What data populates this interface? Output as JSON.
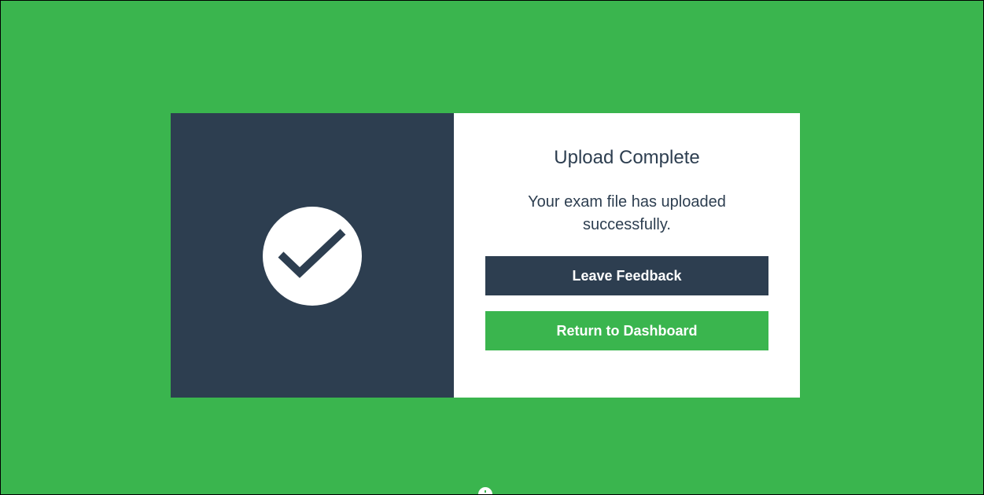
{
  "colors": {
    "background": "#3ab54e",
    "panel_dark": "#2d3e50",
    "panel_light": "#ffffff",
    "accent_green": "#3ab54e"
  },
  "modal": {
    "icon": "checkmark-icon",
    "title": "Upload Complete",
    "message": "Your exam file has uploaded successfully.",
    "buttons": {
      "feedback_label": "Leave Feedback",
      "dashboard_label": "Return to Dashboard"
    }
  },
  "footer": {
    "icon": "info-icon"
  }
}
